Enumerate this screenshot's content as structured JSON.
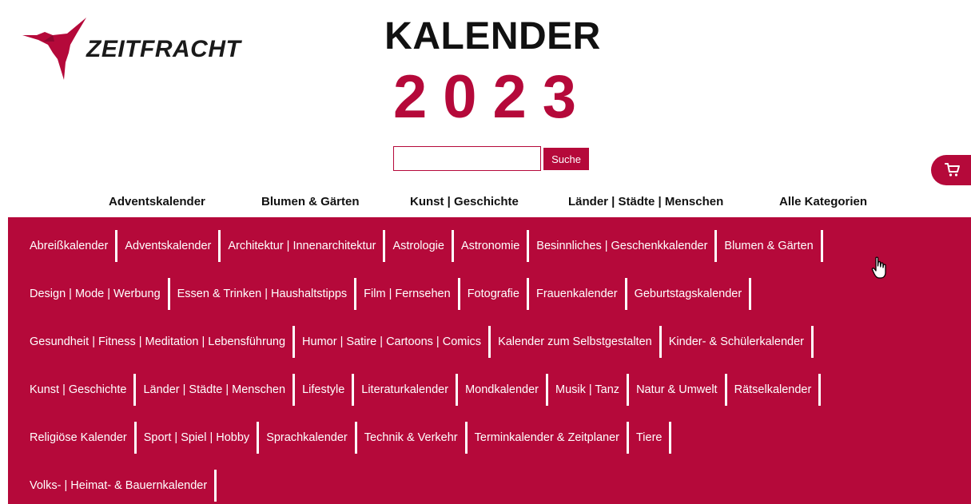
{
  "logo": {
    "brand": "ZEITFRACHT",
    "icon": "hummingbird-logo-icon"
  },
  "title": {
    "word": "KALENDER",
    "year": "2023"
  },
  "search": {
    "placeholder": "",
    "value": "",
    "button_label": "Suche"
  },
  "cart": {
    "icon": "cart-icon"
  },
  "top_nav": [
    "Adventskalender",
    "Blumen & Gärten",
    "Kunst | Geschichte",
    "Länder | Städte | Menschen",
    "Alle Kategorien"
  ],
  "categories": {
    "rows": [
      [
        "Abreißkalender",
        "Adventskalender",
        "Architektur | Innenarchitektur",
        "Astrologie",
        "Astronomie",
        "Besinnliches | Geschenkkalender",
        "Blumen & Gärten"
      ],
      [
        "Design | Mode | Werbung",
        "Essen & Trinken | Haushaltstipps",
        "Film | Fernsehen",
        "Fotografie",
        "Frauenkalender",
        "Geburtstagskalender"
      ],
      [
        "Gesundheit | Fitness | Meditation | Lebensführung",
        "Humor | Satire | Cartoons | Comics",
        "Kalender zum Selbstgestalten",
        "Kinder- & Schülerkalender"
      ],
      [
        "Kunst | Geschichte",
        "Länder | Städte | Menschen",
        "Lifestyle",
        "Literaturkalender",
        "Mondkalender",
        "Musik | Tanz",
        "Natur & Umwelt",
        "Rätselkalender"
      ],
      [
        "Religiöse Kalender",
        "Sport | Spiel | Hobby",
        "Sprachkalender",
        "Technik & Verkehr",
        "Terminkalender & Zeitplaner",
        "Tiere"
      ],
      [
        "Volks- | Heimat- & Bauernkalender"
      ]
    ]
  },
  "colors": {
    "accent": "#b5093a",
    "text": "#111111",
    "background": "#ffffff"
  }
}
